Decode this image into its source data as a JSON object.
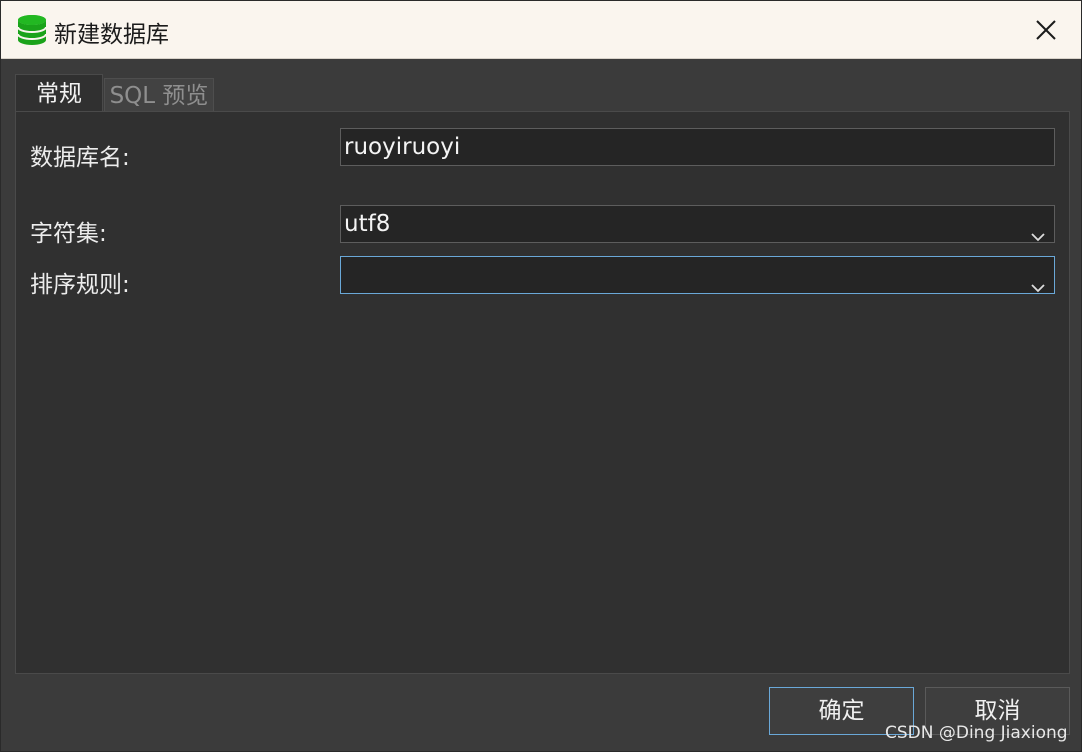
{
  "window": {
    "title": "新建数据库",
    "icon": "database-icon",
    "close_icon": "close-icon"
  },
  "tabs": [
    {
      "label": "常规",
      "active": true
    },
    {
      "label": "SQL 预览",
      "active": false
    }
  ],
  "form": {
    "db_name_label": "数据库名:",
    "db_name_value": "ruoyiruoyi",
    "charset_label": "字符集:",
    "charset_value": "utf8",
    "collation_label": "排序规则:",
    "collation_value": ""
  },
  "buttons": {
    "ok": "确定",
    "cancel": "取消"
  },
  "watermark": "CSDN @Ding Jiaxiong",
  "colors": {
    "accent_border": "#6aa8d8",
    "icon_green": "#1aa31a",
    "panel_bg": "#303030"
  }
}
